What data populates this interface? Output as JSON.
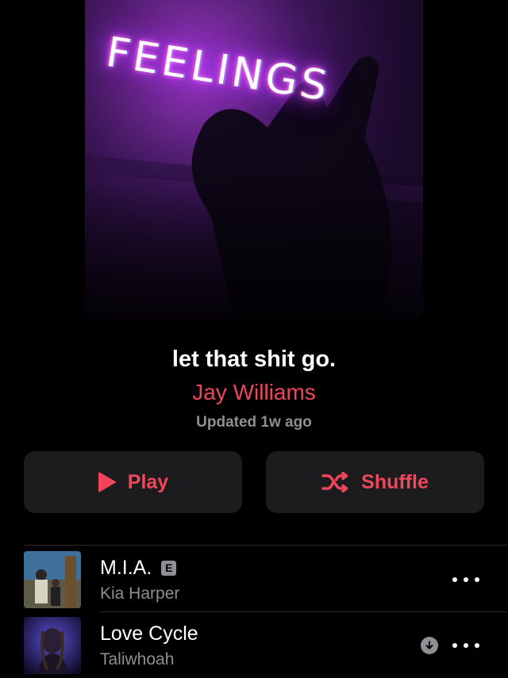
{
  "artwork": {
    "text": "FEELINGS",
    "accent": "#e045ff"
  },
  "playlist": {
    "title": "let that shit go.",
    "curator": "Jay Williams",
    "updated": "Updated 1w ago"
  },
  "actions": {
    "play_label": "Play",
    "shuffle_label": "Shuffle",
    "accent_color": "#f0455a"
  },
  "tracks": [
    {
      "title": "M.I.A.",
      "artist": "Kia Harper",
      "explicit": "E",
      "downloaded": false
    },
    {
      "title": "Love Cycle",
      "artist": "Taliwhoah",
      "downloaded": true
    }
  ]
}
